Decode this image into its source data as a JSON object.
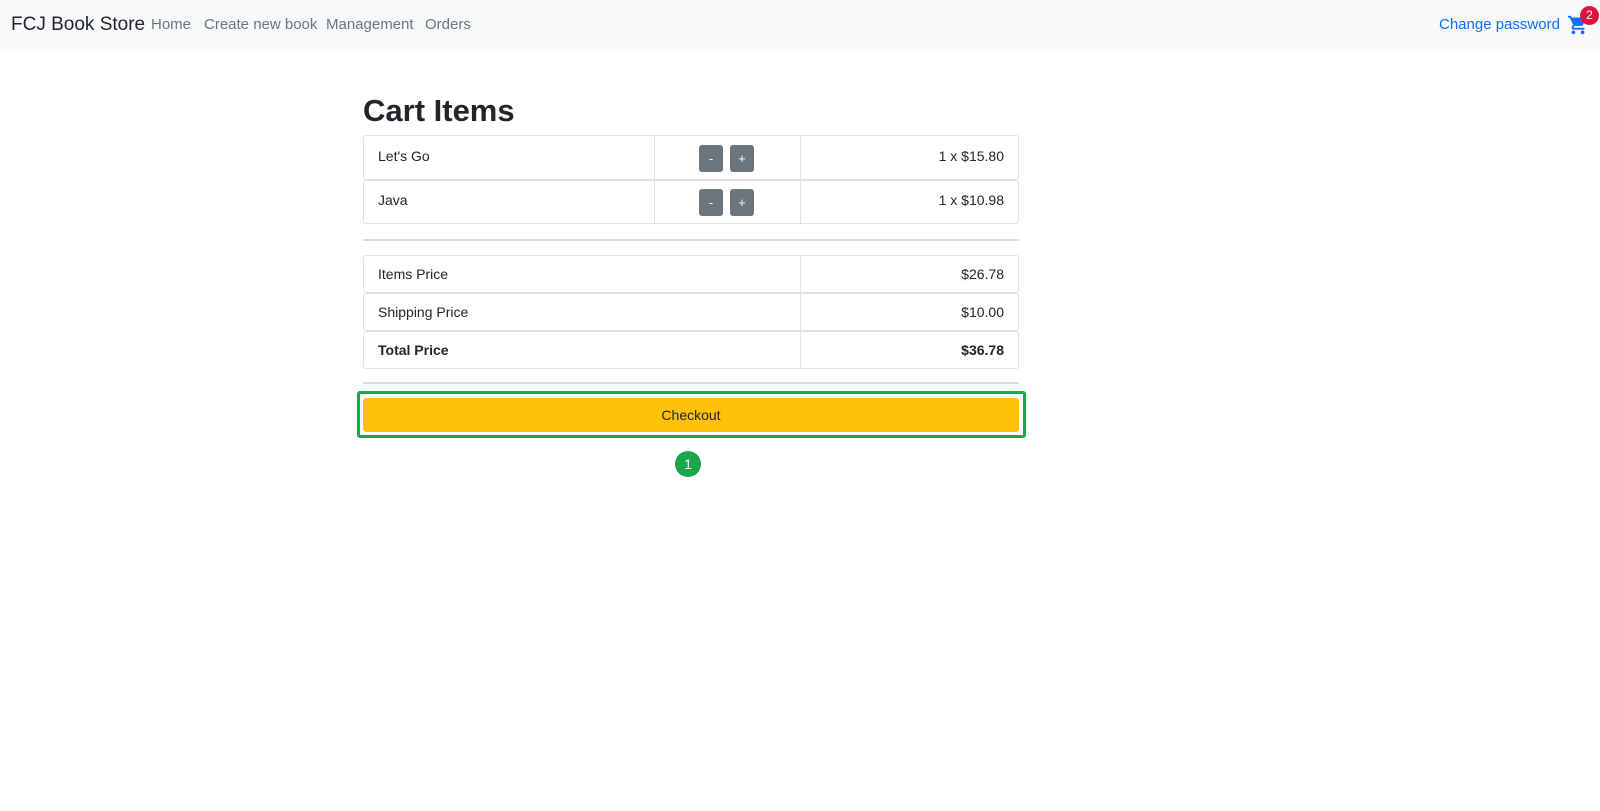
{
  "navbar": {
    "brand": "FCJ Book Store",
    "links": [
      "Home",
      "Create new book",
      "Management",
      "Orders"
    ],
    "right_link": "Change password",
    "cart_icon": "shopping-cart-icon",
    "cart_count": "2"
  },
  "main": {
    "title": "Cart Items",
    "cart_items": [
      {
        "name": "Let's Go",
        "minus": "-",
        "plus": "+",
        "price": "1 x $15.80"
      },
      {
        "name": "Java",
        "minus": "-",
        "plus": "+",
        "price": "1 x $10.98"
      }
    ],
    "summary": [
      {
        "label": "Items Price",
        "value": "$26.78"
      },
      {
        "label": "Shipping Price",
        "value": "$10.00"
      },
      {
        "label": "Total Price",
        "value": "$36.78"
      }
    ],
    "checkout_label": "Checkout",
    "marker_label": "1"
  },
  "colors": {
    "accent": "#ffc107",
    "highlight": "#1aa84b",
    "link": "#0d6efd",
    "badge": "#dc143c"
  }
}
